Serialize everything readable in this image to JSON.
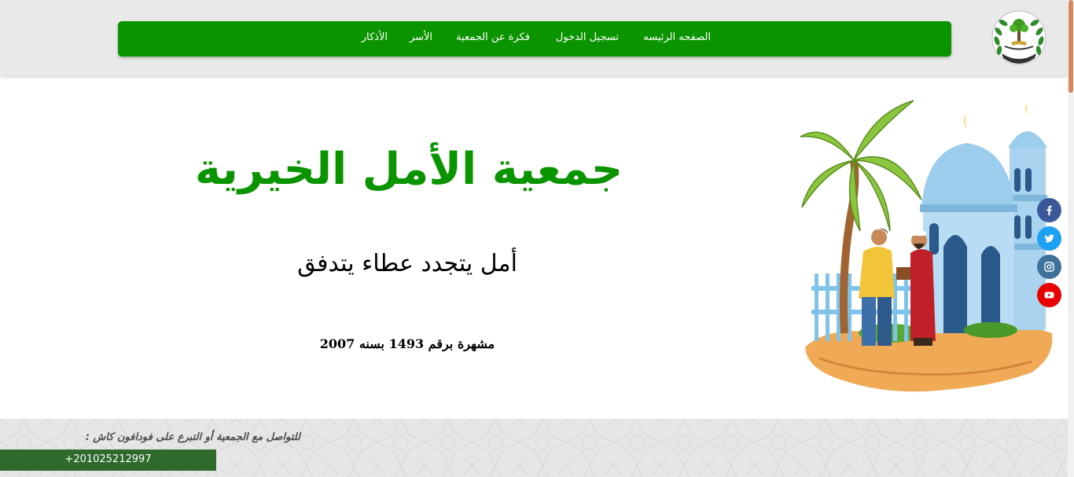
{
  "header": {
    "logo_icon": "charity-tree-emblem",
    "nav": [
      {
        "label": "الصفحه الرئيسه"
      },
      {
        "label": "تسجيل الدخول"
      },
      {
        "label": "فكرة عن الجمعية"
      },
      {
        "label": "الأسر"
      },
      {
        "label": "الأذكار"
      }
    ],
    "nav_color": "#0a9400"
  },
  "hero": {
    "title": "جمعية الأمل الخيرية",
    "tagline": "أمل يتجدد عطاء يتدفق",
    "registration": "مشهرة برقم 1493 بسنه 2007",
    "title_color": "#0a9400",
    "illustration_icon": "mosque-charity-illustration"
  },
  "social": [
    {
      "name": "facebook",
      "icon": "facebook-icon",
      "color": "#3b5998"
    },
    {
      "name": "twitter",
      "icon": "twitter-icon",
      "color": "#1da1f2"
    },
    {
      "name": "instagram",
      "icon": "instagram-icon",
      "color": "#3f729b"
    },
    {
      "name": "youtube",
      "icon": "youtube-icon",
      "color": "#e60000"
    }
  ],
  "footer": {
    "contact_label": "للتواصل مع الجمعية أو التبرع على فودافون كاش :",
    "phone": "+201025212997",
    "phone_box_color": "#2e6a2b"
  }
}
